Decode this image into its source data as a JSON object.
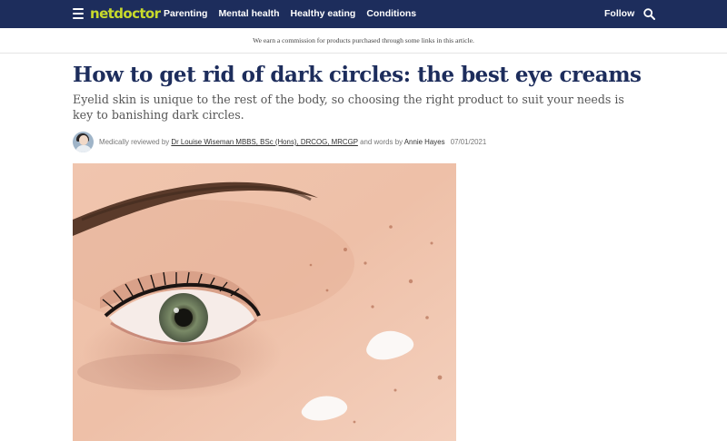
{
  "header": {
    "logo_text": "netdoctor",
    "nav_items": [
      {
        "label": "Parenting"
      },
      {
        "label": "Mental health"
      },
      {
        "label": "Healthy eating"
      },
      {
        "label": "Conditions"
      }
    ],
    "follow_label": "Follow",
    "icons": {
      "menu": "hamburger-menu-icon",
      "search": "search-icon"
    },
    "colors": {
      "background": "#1d2d5c",
      "logo": "#c8da2b"
    }
  },
  "disclosure": "We earn a commission for products purchased through some links in this article.",
  "article": {
    "title": "How to get rid of dark circles: the best eye creams",
    "dek": "Eyelid skin is unique to the rest of the body, so choosing the right product to suit your needs is key to banishing dark circles.",
    "byline": {
      "reviewed_prefix": "Medically reviewed by",
      "reviewer": "Dr Louise Wiseman MBBS, BSc (Hons), DRCOG, MRCGP",
      "and_words_by": "and words by",
      "author": "Annie Hayes",
      "date": "07/01/2021"
    }
  }
}
